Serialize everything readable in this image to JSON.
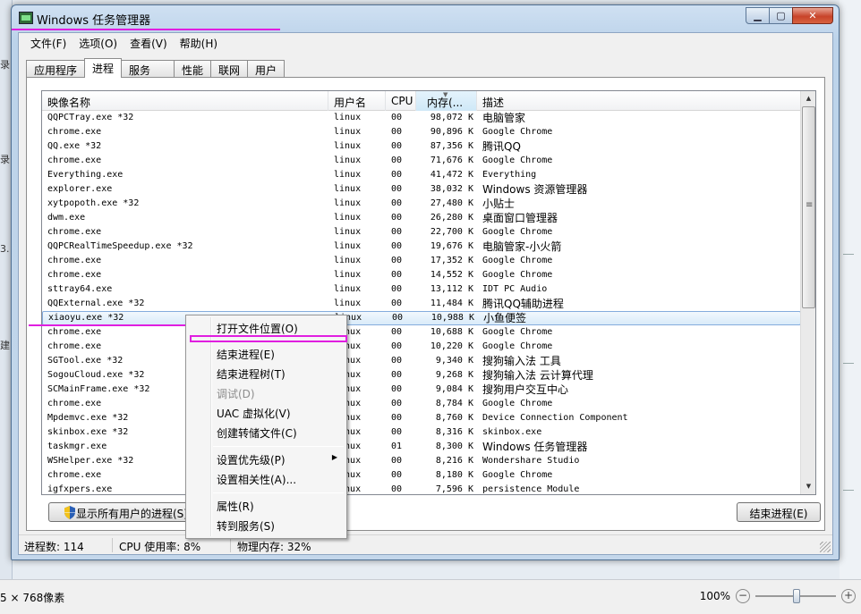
{
  "window": {
    "title": "Windows 任务管理器"
  },
  "menu": [
    "文件(F)",
    "选项(O)",
    "查看(V)",
    "帮助(H)"
  ],
  "tabs": [
    "应用程序",
    "进程",
    "服务",
    "性能",
    "联网",
    "用户"
  ],
  "active_tab": "进程",
  "columns": {
    "name": "映像名称",
    "user": "用户名",
    "cpu": "CPU",
    "mem": "内存(...",
    "desc": "描述"
  },
  "processes": [
    {
      "name": "QQPCTray.exe *32",
      "user": "linux",
      "cpu": "00",
      "mem": "98,072 K",
      "desc": "电脑管家"
    },
    {
      "name": "chrome.exe",
      "user": "linux",
      "cpu": "00",
      "mem": "90,896 K",
      "desc": "Google Chrome"
    },
    {
      "name": "QQ.exe *32",
      "user": "linux",
      "cpu": "00",
      "mem": "87,356 K",
      "desc": "腾讯QQ"
    },
    {
      "name": "chrome.exe",
      "user": "linux",
      "cpu": "00",
      "mem": "71,676 K",
      "desc": "Google Chrome"
    },
    {
      "name": "Everything.exe",
      "user": "linux",
      "cpu": "00",
      "mem": "41,472 K",
      "desc": "Everything"
    },
    {
      "name": "explorer.exe",
      "user": "linux",
      "cpu": "00",
      "mem": "38,032 K",
      "desc": "Windows 资源管理器"
    },
    {
      "name": "xytpopoth.exe *32",
      "user": "linux",
      "cpu": "00",
      "mem": "27,480 K",
      "desc": "小贴士"
    },
    {
      "name": "dwm.exe",
      "user": "linux",
      "cpu": "00",
      "mem": "26,280 K",
      "desc": "桌面窗口管理器"
    },
    {
      "name": "chrome.exe",
      "user": "linux",
      "cpu": "00",
      "mem": "22,700 K",
      "desc": "Google Chrome"
    },
    {
      "name": "QQPCRealTimeSpeedup.exe *32",
      "user": "linux",
      "cpu": "00",
      "mem": "19,676 K",
      "desc": "电脑管家-小火箭"
    },
    {
      "name": "chrome.exe",
      "user": "linux",
      "cpu": "00",
      "mem": "17,352 K",
      "desc": "Google Chrome"
    },
    {
      "name": "chrome.exe",
      "user": "linux",
      "cpu": "00",
      "mem": "14,552 K",
      "desc": "Google Chrome"
    },
    {
      "name": "sttray64.exe",
      "user": "linux",
      "cpu": "00",
      "mem": "13,112 K",
      "desc": "IDT PC Audio"
    },
    {
      "name": "QQExternal.exe *32",
      "user": "linux",
      "cpu": "00",
      "mem": "11,484 K",
      "desc": "腾讯QQ辅助进程"
    },
    {
      "name": "xiaoyu.exe *32",
      "user": "linux",
      "cpu": "00",
      "mem": "10,988 K",
      "desc": "小鱼便签",
      "selected": true
    },
    {
      "name": "chrome.exe",
      "user": "linux",
      "cpu": "00",
      "mem": "10,688 K",
      "desc": "Google Chrome"
    },
    {
      "name": "chrome.exe",
      "user": "linux",
      "cpu": "00",
      "mem": "10,220 K",
      "desc": "Google Chrome"
    },
    {
      "name": "SGTool.exe *32",
      "user": "linux",
      "cpu": "00",
      "mem": "9,340 K",
      "desc": "搜狗输入法 工具"
    },
    {
      "name": "SogouCloud.exe *32",
      "user": "linux",
      "cpu": "00",
      "mem": "9,268 K",
      "desc": "搜狗输入法 云计算代理"
    },
    {
      "name": "SCMainFrame.exe *32",
      "user": "linux",
      "cpu": "00",
      "mem": "9,084 K",
      "desc": "搜狗用户交互中心"
    },
    {
      "name": "chrome.exe",
      "user": "linux",
      "cpu": "00",
      "mem": "8,784 K",
      "desc": "Google Chrome"
    },
    {
      "name": "Mpdemvc.exe *32",
      "user": "linux",
      "cpu": "00",
      "mem": "8,760 K",
      "desc": "Device Connection Component"
    },
    {
      "name": "skinbox.exe *32",
      "user": "linux",
      "cpu": "00",
      "mem": "8,316 K",
      "desc": "skinbox.exe"
    },
    {
      "name": "taskmgr.exe",
      "user": "linux",
      "cpu": "01",
      "mem": "8,300 K",
      "desc": "Windows 任务管理器"
    },
    {
      "name": "WSHelper.exe *32",
      "user": "linux",
      "cpu": "00",
      "mem": "8,216 K",
      "desc": "Wondershare Studio"
    },
    {
      "name": "chrome.exe",
      "user": "linux",
      "cpu": "00",
      "mem": "8,180 K",
      "desc": "Google Chrome"
    },
    {
      "name": "igfxpers.exe",
      "user": "linux",
      "cpu": "00",
      "mem": "7,596 K",
      "desc": "persistence Module"
    }
  ],
  "buttons": {
    "show_all": "显示所有用户的进程(S)",
    "end_process": "结束进程(E)"
  },
  "status": {
    "processes": "进程数: 114",
    "cpu": "CPU 使用率: 8%",
    "memory": "物理内存: 32%"
  },
  "context_menu": {
    "open_location": "打开文件位置(O)",
    "end_process": "结束进程(E)",
    "end_tree": "结束进程树(T)",
    "debug": "调试(D)",
    "uac": "UAC 虚拟化(V)",
    "dump": "创建转储文件(C)",
    "priority": "设置优先级(P)",
    "affinity": "设置相关性(A)...",
    "properties": "属性(R)",
    "goto_service": "转到服务(S)"
  },
  "background": {
    "left_fragments": [
      "录",
      "录",
      "3.",
      "建"
    ],
    "status_left": "5 × 768像素",
    "zoom": "100%"
  },
  "colors": {
    "annotation": "#e01ee0",
    "close_button": "#c8442a",
    "selection": "#d9ebf9"
  }
}
